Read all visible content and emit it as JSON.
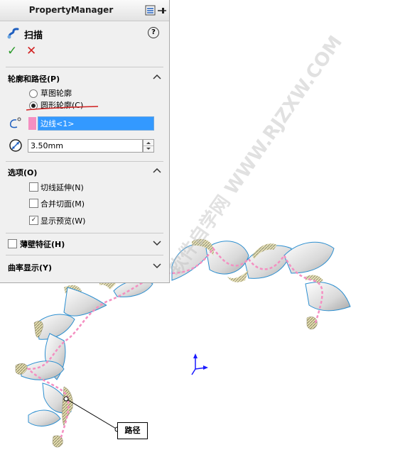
{
  "property_manager": {
    "title": "PropertyManager",
    "feature_name": "扫描",
    "help_glyph": "?",
    "ok_glyph": "✓",
    "cancel_glyph": "✕"
  },
  "profile_path_section": {
    "title": "轮廓和路径(P)",
    "options": [
      {
        "label": "草图轮廓",
        "selected": false
      },
      {
        "label": "圆形轮廓(C)",
        "selected": true
      }
    ],
    "path_field_value": "边线<1>",
    "diameter_value": "3.50mm"
  },
  "options_section": {
    "title": "选项(O)",
    "checkboxes": [
      {
        "label": "切线延伸(N)",
        "checked": false
      },
      {
        "label": "合并切面(M)",
        "checked": false
      },
      {
        "label": "显示预览(W)",
        "checked": true
      }
    ]
  },
  "thin_feature": {
    "label": "薄壁特征(H)",
    "checked": false
  },
  "curvature_display": {
    "title": "曲率显示(Y)"
  },
  "viewport": {
    "path_callout": "路径",
    "watermark": "软件自学网 WWW.RJZXW.COM"
  },
  "colors": {
    "selection_blue": "#3399ff",
    "path_pink": "#f48fc1",
    "edge_blue": "#2d8fd0",
    "ok_green": "#2a9a2a",
    "cancel_red": "#d22222",
    "annotation_red": "#d02020"
  },
  "icons": [
    "sweep-icon",
    "help-icon",
    "ok-icon",
    "cancel-icon",
    "pin-icon",
    "collapse-icon",
    "path-icon",
    "diameter-icon",
    "triad-icon"
  ]
}
